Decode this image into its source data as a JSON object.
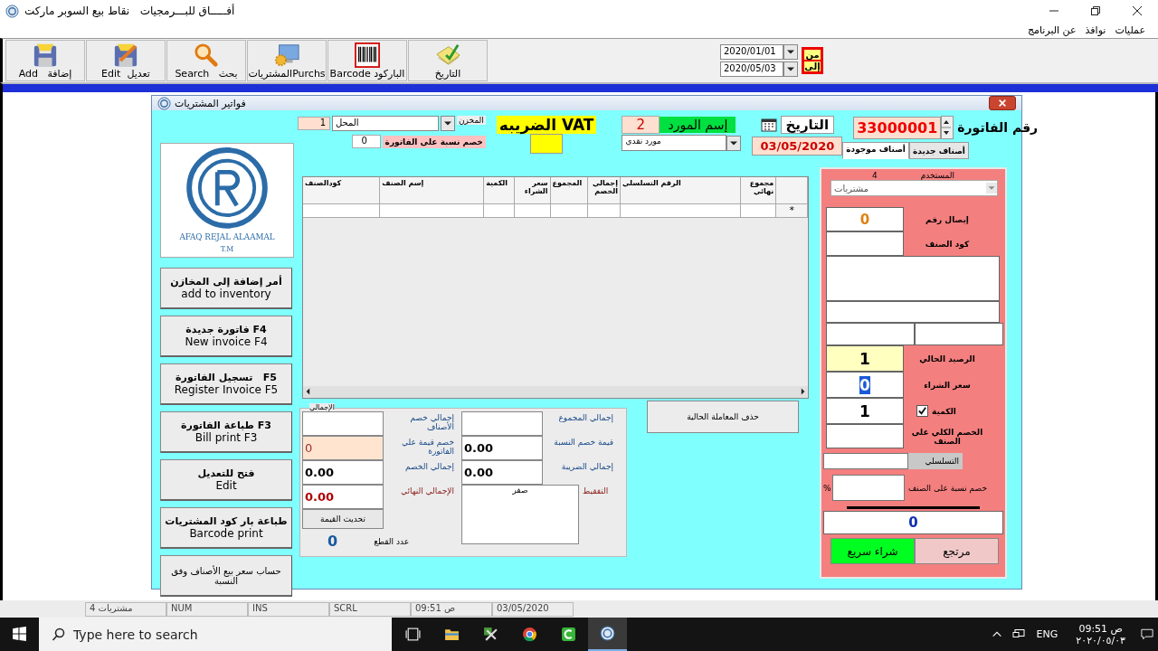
{
  "app": {
    "title": "أفـــــاق للبـــرمجيات   نقاط بيع السوبر ماركت"
  },
  "menu": [
    {
      "label": "عمليات"
    },
    {
      "label": "نوافذ"
    },
    {
      "label": "عن البرنامج"
    }
  ],
  "toolbar": [
    {
      "kind": "date",
      "label": "التاريخ"
    },
    {
      "kind": "barcode",
      "label": "Barcode الباركود"
    },
    {
      "kind": "purchases",
      "label": "المشترياتPurchs"
    },
    {
      "kind": "search",
      "label": "Search   بحث"
    },
    {
      "kind": "edit",
      "label": "Edit  تعديل"
    },
    {
      "kind": "add",
      "label": "Add   إضافة"
    }
  ],
  "date_range": {
    "from_label": "من",
    "from": "2020/01/01",
    "to_label": "إلى",
    "to": "2020/05/03"
  },
  "dialog": {
    "title": "فواتير المشتريات",
    "warehouse": {
      "label": "المخزن",
      "value": "المحل",
      "code": "1"
    },
    "invoice_discount": {
      "label": "خصم نسبة على الفاتورة",
      "value": "0"
    },
    "vat": {
      "label": "الضريبه VAT"
    },
    "supplier": {
      "label": "إسم المورد",
      "code": "2",
      "value": "مورد نقدي"
    },
    "date": {
      "label": "التاريخ",
      "value": "03/05/2020"
    },
    "invoice_number": {
      "label": "رقم الفاتورة",
      "value": "33000001"
    },
    "tabs": [
      {
        "label": "أصناف جديدة",
        "selected": false
      },
      {
        "label": "أصناف موجودة",
        "selected": true
      }
    ],
    "logo": {
      "text": "AFAQ REJAL ALAAMAL",
      "mark": "T.M"
    },
    "actions": [
      {
        "label": "أمر إضافة إلى المخازن",
        "sub": "add to inventory"
      },
      {
        "label": "F4 فاتورة جديدة",
        "sub": "New invoice F4"
      },
      {
        "label": "F5   تسجيل الفاتورة",
        "sub": "Register Invoice F5"
      },
      {
        "label": "F3 طباعة الفاتورة",
        "sub": "Bill print F3"
      },
      {
        "label": "فتح للتعديل",
        "sub": "Edit"
      },
      {
        "label": "طباعة بار كود المشتريات",
        "sub": "Barcode print"
      },
      {
        "label": "حساب سعر بيع الأصناف وفق النسبة"
      }
    ],
    "table": {
      "columns": [
        "مجموع نهائي",
        "الرقم التسلسلي",
        "إجمالي الخصم",
        "المجموع",
        "سعر الشراء",
        "الكمية",
        "إسم الصنف",
        "كودالصنف"
      ],
      "new_row_marker": "*"
    },
    "totals": {
      "legend": "الإجمالي",
      "left": [
        {
          "label": "إجمالي خصم الأصناف",
          "kind": "plain"
        },
        {
          "label": "خصم قيمة علي الفاتورة",
          "value": "0",
          "kind": "edited"
        },
        {
          "label": "إجمالي الخصم",
          "value": "0.00",
          "kind": "plain"
        },
        {
          "label": "الإجمالي النهائي",
          "value": "0.00",
          "kind": "final"
        }
      ],
      "right": [
        {
          "label": "إجمالي المجموع"
        },
        {
          "label": "قيمة خصم النسبة",
          "value": "0.00"
        },
        {
          "label": "إجمالي الضريبة",
          "value": "0.00"
        }
      ],
      "in_words": {
        "label": "التفقيط",
        "value": "صفر"
      },
      "refresh_button": "تحديث القيمة",
      "pieces": {
        "label": "عدد القطع",
        "value": "0"
      }
    },
    "delete_button": "حذف المعاملة الحالية",
    "item_panel": {
      "user": {
        "label": "المستخدم",
        "id": "4",
        "value": "مشتريات"
      },
      "receipt": {
        "label": "إيصال رقم",
        "value": "0"
      },
      "item_code": {
        "label": "كود الصنف"
      },
      "balance": {
        "label": "الرصيد الحالي",
        "value": "1"
      },
      "price": {
        "label": "سعر الشراء",
        "value": "0"
      },
      "quantity": {
        "label": "الكمية",
        "value": "1",
        "checked": true
      },
      "item_discount": {
        "label": "الخصم الكلي على الصنف"
      },
      "serial": {
        "label": "التسلسلي"
      },
      "percent_discount": {
        "label": "خصم نسبة على الصنف",
        "unit": "%"
      },
      "total": "0",
      "quick_buy": "شراء سريع",
      "return": "مرتجع"
    }
  },
  "status_bar": [
    "03/05/2020",
    "09:51 ص",
    "SCRL",
    "INS",
    "NUM",
    "مشتريات 4"
  ],
  "taskbar": {
    "search_placeholder": "Type here to search",
    "language": "ENG",
    "time": "09:51 ص",
    "date": "٢٠٢٠/٠٥/٠٣"
  }
}
